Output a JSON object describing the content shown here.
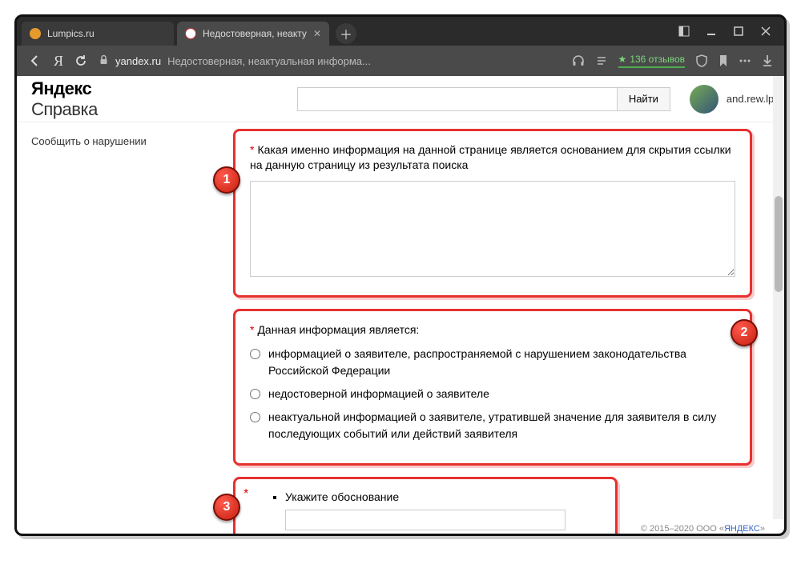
{
  "browser": {
    "tabs": [
      {
        "title": "Lumpics.ru",
        "favicon_color": "#e49a2d",
        "active": false
      },
      {
        "title": "Недостоверная, неакту",
        "favicon_color": "#c33",
        "active": true
      }
    ],
    "address": {
      "domain": "yandex.ru",
      "title": "Недостоверная, неактуальная информа..."
    },
    "reviews_label": "136 отзывов"
  },
  "yandex_header": {
    "logo_bold": "Яндекс",
    "logo_light": "Справка",
    "search_button": "Найти",
    "username": "and.rew.lptw"
  },
  "sidebar": {
    "item": "Сообщить о нарушении"
  },
  "form": {
    "q1_label": "Какая именно информация на данной странице является основанием для скрытия ссылки на данную страницу из результата поиска",
    "q2_label": "Данная информация является:",
    "q2_opt1": "информацией о заявителе, распространяемой с нарушением законодательства Российской Федерации",
    "q2_opt2": "недостоверной информацией о заявителе",
    "q2_opt3": "неактуальной информацией о заявителе, утратившей значение для заявителя в силу последующих событий или действий заявителя",
    "q3_label": "Укажите обоснование"
  },
  "footer": {
    "copyright": "© 2015–2020  ООО «",
    "link": "ЯНДЕКС",
    "tail": "»"
  },
  "annotations": {
    "n1": "1",
    "n2": "2",
    "n3": "3"
  }
}
